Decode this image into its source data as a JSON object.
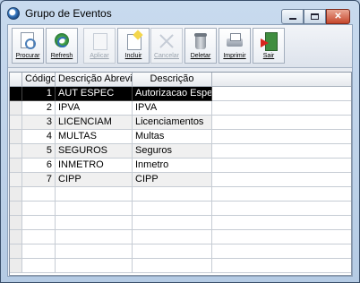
{
  "window": {
    "title": "Grupo de Eventos"
  },
  "toolbar": {
    "buttons": [
      {
        "label": "Procurar",
        "icon": "search-icon",
        "enabled": true
      },
      {
        "label": "Refresh",
        "icon": "refresh-icon",
        "enabled": true
      },
      {
        "label": "Aplicar",
        "icon": "apply-icon",
        "enabled": false
      },
      {
        "label": "Incluir",
        "icon": "new-icon",
        "enabled": true
      },
      {
        "label": "Cancelar",
        "icon": "cancel-icon",
        "enabled": false
      },
      {
        "label": "Deletar",
        "icon": "trash-icon",
        "enabled": true
      },
      {
        "label": "Imprimir",
        "icon": "printer-icon",
        "enabled": true
      },
      {
        "label": "Sair",
        "icon": "exit-icon",
        "enabled": true
      }
    ]
  },
  "grid": {
    "headers": {
      "codigo": "Código",
      "abreviada": "Descrição Abreviada",
      "descricao": "Descrição"
    },
    "rows": [
      {
        "codigo": "1",
        "abreviada": "AUT ESPEC",
        "descricao": "Autorizacao Especial",
        "selected": true
      },
      {
        "codigo": "2",
        "abreviada": "IPVA",
        "descricao": "IPVA"
      },
      {
        "codigo": "3",
        "abreviada": "LICENCIAM",
        "descricao": "Licenciamentos"
      },
      {
        "codigo": "4",
        "abreviada": "MULTAS",
        "descricao": "Multas"
      },
      {
        "codigo": "5",
        "abreviada": "SEGUROS",
        "descricao": "Seguros"
      },
      {
        "codigo": "6",
        "abreviada": "INMETRO",
        "descricao": "Inmetro"
      },
      {
        "codigo": "7",
        "abreviada": "CIPP",
        "descricao": "CIPP"
      }
    ],
    "selection_color": "#000000"
  }
}
